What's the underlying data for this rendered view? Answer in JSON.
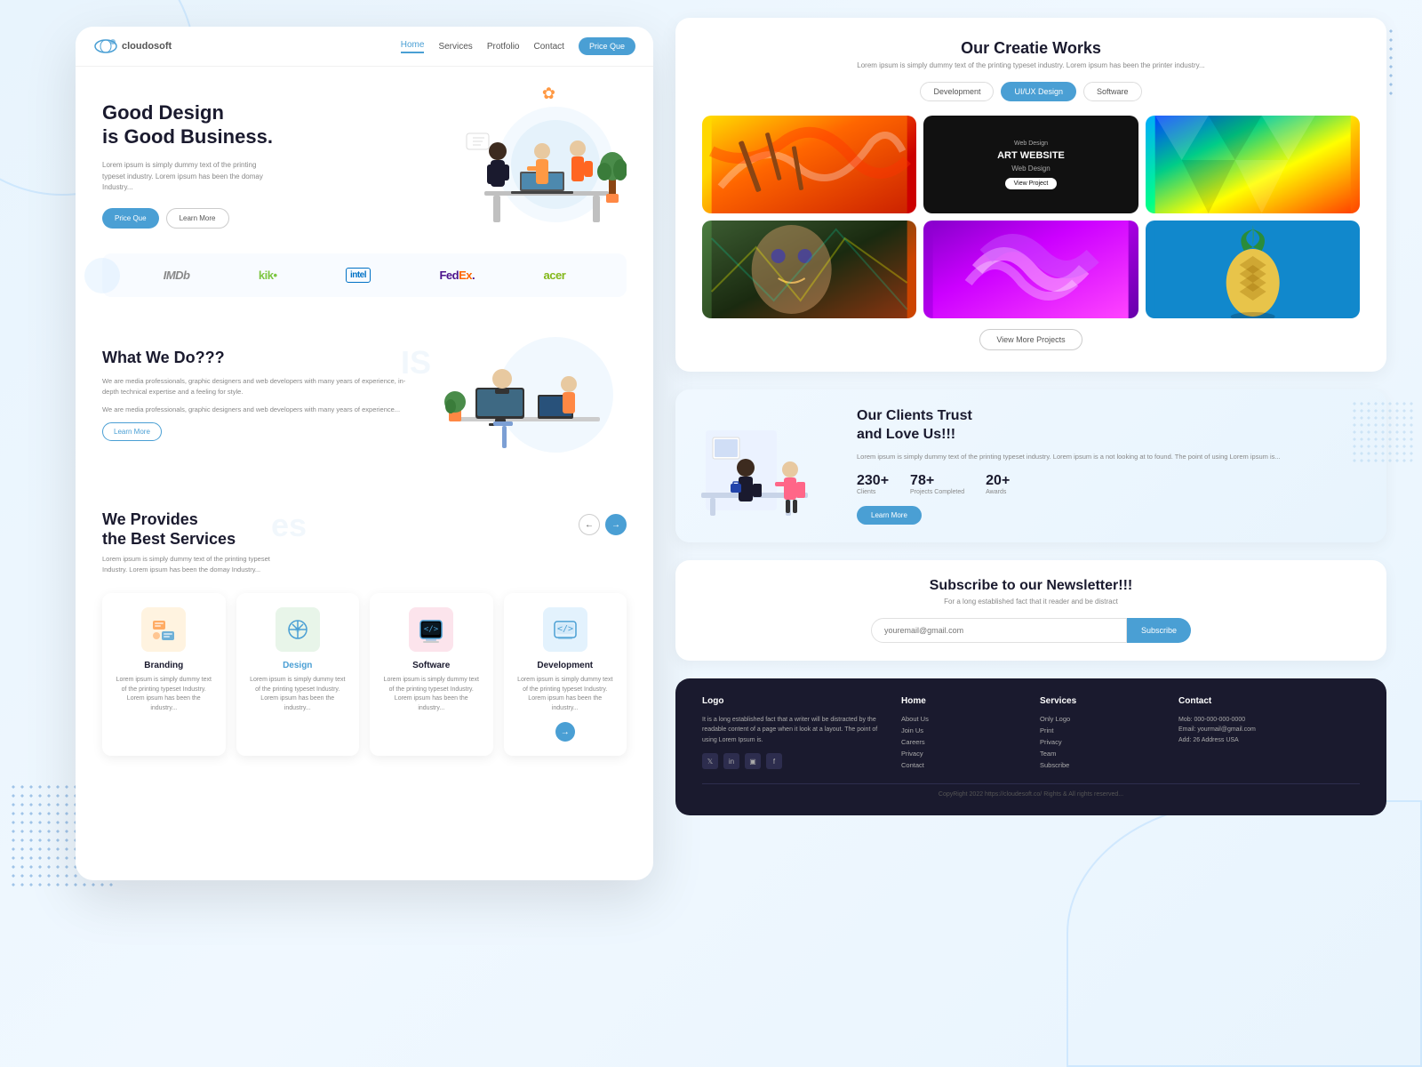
{
  "meta": {
    "bg_color": "#e8f4fd"
  },
  "left_panel": {
    "navbar": {
      "logo": "cloudosoft",
      "links": [
        "Home",
        "Services",
        "Protfolio",
        "Contact"
      ],
      "active_link": "Home",
      "btn_label": "Price Que"
    },
    "hero": {
      "title_line1": "Good Design",
      "title_line2": "is Good Business.",
      "description": "Lorem ipsum is simply dummy text of the printing typeset industry. Lorem ipsum has been the domay Industry...",
      "btn_primary": "Price Que",
      "btn_secondary": "Learn More"
    },
    "partners": [
      "IMDb",
      "kik•",
      "intel",
      "FedEx.",
      "acer"
    ],
    "what_we_do": {
      "title": "What We Do???",
      "description1": "We are media professionals, graphic designers and web developers with many years of experience, in-depth technical expertise and a feeling for style.",
      "description2": "We are media professionals, graphic designers and web developers with many years of experience...",
      "btn_label": "Learn More"
    },
    "services": {
      "title_line1": "We Provides",
      "title_line2": "the Best Services",
      "description": "Lorem ipsum is simply dummy text of the printing typeset Industry. Lorem ipsum has been the domay Industry...",
      "cards": [
        {
          "name": "Branding",
          "icon": "🗂",
          "icon_style": "branding",
          "description": "Lorem ipsum is simply dummy text of the printing typeset Industry. Lorem ipsum has been the industry...",
          "active": false
        },
        {
          "name": "Design",
          "icon": "✏",
          "icon_style": "design",
          "description": "Lorem ipsum is simply dummy text of the printing typeset Industry. Lorem ipsum has been the industry...",
          "active": true
        },
        {
          "name": "Software",
          "icon": "💻",
          "icon_style": "software",
          "description": "Lorem ipsum is simply dummy text of the printing typeset Industry. Lorem ipsum has been the industry...",
          "active": false
        },
        {
          "name": "Development",
          "icon": "</> ",
          "icon_style": "development",
          "description": "Lorem ipsum is simply dummy text of the printing typeset Industry. Lorem ipsum has been the industry...",
          "active": false
        }
      ]
    }
  },
  "right_panel": {
    "creative_works": {
      "title": "Our Creatie Works",
      "subtitle": "Lorem ipsum is simply dummy text of the printing typeset industry. Lorem ipsum has been the printer industry...",
      "tabs": [
        "Development",
        "UI/UX Design",
        "Software"
      ],
      "active_tab": "UI/UX Design",
      "gallery": [
        {
          "type": "brushes",
          "label": "",
          "title": ""
        },
        {
          "type": "website",
          "label": "Web Design",
          "title": "ART WEBSITE",
          "btn": "View Project"
        },
        {
          "type": "colorful",
          "label": "",
          "title": ""
        },
        {
          "type": "face",
          "label": "",
          "title": ""
        },
        {
          "type": "purple",
          "label": "",
          "title": ""
        },
        {
          "type": "pineapple",
          "label": "",
          "title": ""
        }
      ],
      "view_more_btn": "View More Projects"
    },
    "trust": {
      "title": "Our Clients Trust\nand Love Us!!!",
      "description": "Lorem ipsum is simply dummy text of the printing typeset industry. Lorem ipsum is a not looking at to found. The point of using Lorem ipsum is...",
      "stats": [
        {
          "number": "230+",
          "label": "Clients"
        },
        {
          "number": "78+",
          "label": "Projects Completed"
        },
        {
          "number": "20+",
          "label": "Awards"
        }
      ],
      "btn_label": "Learn More"
    },
    "newsletter": {
      "title": "Subscribe to our Newsletter!!!",
      "description": "For a long established fact that it reader and be distract",
      "input_placeholder": "youremail@gmail.com",
      "btn_label": "Subscribe"
    },
    "footer": {
      "columns": [
        {
          "title": "Logo",
          "content": "It is a long established fact that a writer will be distracted by the readable content of a page when it look at a layout. The point of using Lorem Ipsum is.",
          "social": [
            "𝕏",
            "in",
            "𝔽",
            "f"
          ]
        },
        {
          "title": "Home",
          "links": [
            "About Us",
            "Join Us",
            "Careers",
            "Privacy",
            "Contact"
          ]
        },
        {
          "title": "Services",
          "links": [
            "Only Logo",
            "Print",
            "Privacy",
            "Team",
            "Subscribe"
          ]
        },
        {
          "title": "Contact",
          "info": [
            "Mob: 000-000-000-0000",
            "Email: yourmail@gmail.com",
            "Add: 26 Address USA"
          ]
        }
      ],
      "copyright": "CopyRight 2022 https://cloudesoft.co/ Rights & All rights reserved..."
    }
  }
}
